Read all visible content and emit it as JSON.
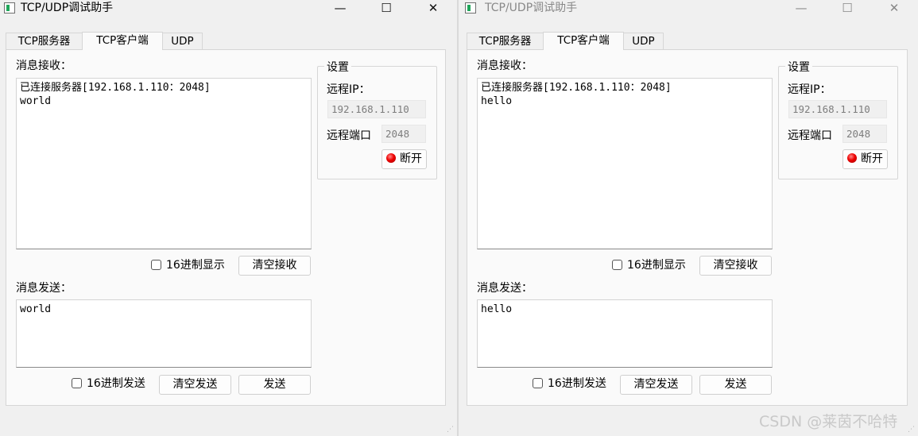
{
  "windows": [
    {
      "title": "TCP/UDP调试助手",
      "controls": {
        "minimize": "—",
        "maximize": "☐",
        "close": "✕"
      },
      "tabs": [
        "TCP服务器",
        "TCP客户端",
        "UDP"
      ],
      "active_tab": "TCP客户端",
      "receive": {
        "label": "消息接收：",
        "lines": [
          "已连接服务器[192.168.1.110：2048]",
          "world"
        ],
        "hex_display_label": "16进制显示",
        "hex_display_checked": false,
        "clear_button": "清空接收"
      },
      "send": {
        "label": "消息发送：",
        "text": "world",
        "hex_send_label": "16进制发送",
        "hex_send_checked": false,
        "clear_button": "清空发送",
        "send_button": "发送"
      },
      "settings": {
        "title": "设置",
        "remote_ip_label": "远程IP：",
        "remote_ip_value": "192.168.1.110",
        "remote_port_label": "远程端口",
        "remote_port_value": "2048",
        "disconnect_button": "断开",
        "status_led_color": "#e00000"
      }
    },
    {
      "title": "TCP/UDP调试助手",
      "controls": {
        "minimize": "—",
        "maximize": "☐",
        "close": "✕"
      },
      "tabs": [
        "TCP服务器",
        "TCP客户端",
        "UDP"
      ],
      "active_tab": "TCP客户端",
      "receive": {
        "label": "消息接收：",
        "lines": [
          "已连接服务器[192.168.1.110：2048]",
          "hello"
        ],
        "hex_display_label": "16进制显示",
        "hex_display_checked": false,
        "clear_button": "清空接收"
      },
      "send": {
        "label": "消息发送：",
        "text": "hello",
        "hex_send_label": "16进制发送",
        "hex_send_checked": false,
        "clear_button": "清空发送",
        "send_button": "发送"
      },
      "settings": {
        "title": "设置",
        "remote_ip_label": "远程IP：",
        "remote_ip_value": "192.168.1.110",
        "remote_port_label": "远程端口",
        "remote_port_value": "2048",
        "disconnect_button": "断开",
        "status_led_color": "#e00000"
      }
    }
  ],
  "watermark": "CSDN @莱茵不哈特",
  "colors": {
    "window_bg": "#f0f0f0",
    "pane_bg": "#fafafa",
    "led_red": "#e00000"
  }
}
